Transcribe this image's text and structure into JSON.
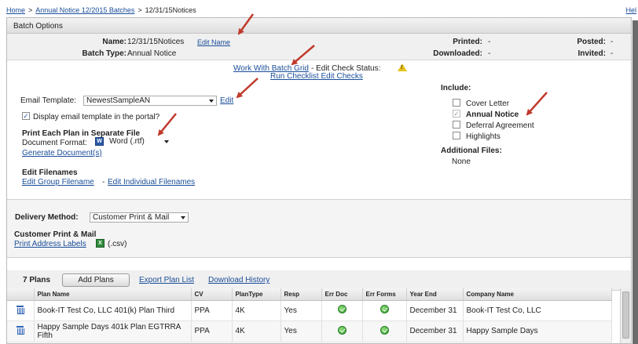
{
  "breadcrumb": {
    "home": "Home",
    "batches": "Annual Notice 12/2015 Batches",
    "current": "12/31/15Notices",
    "separator": ">",
    "help_fragment": "Hel"
  },
  "panel": {
    "title": "Batch Options"
  },
  "info": {
    "name_label": "Name:",
    "name_value": "12/31/15Notices",
    "edit_name": "Edit Name",
    "batch_type_label": "Batch Type:",
    "batch_type_value": "Annual Notice",
    "printed_label": "Printed:",
    "printed_value": "-",
    "downloaded_label": "Downloaded:",
    "downloaded_value": "-",
    "posted_label": "Posted:",
    "posted_value": "-",
    "invited_label": "Invited:",
    "invited_value": "-"
  },
  "main": {
    "work_with_batch_grid": "Work With Batch Grid",
    "edit_check_status": "- Edit Check Status:",
    "run_checklist": "Run Checklist Edit Checks",
    "email_template_label": "Email Template:",
    "email_template_value": "NewestSampleAN",
    "edit_template": "Edit",
    "display_template_label": "Display email template in the portal?",
    "display_template_checked": true,
    "print_each_plan": "Print Each Plan in Separate File",
    "document_format_label": "Document Format:",
    "document_format_value": "Word (.rtf)",
    "generate_documents": "Generate Document(s)",
    "edit_filenames": "Edit Filenames",
    "edit_group_filename": "Edit Group Filename",
    "filename_separator": "-",
    "edit_individual_filenames": "Edit Individual Filenames",
    "include_label": "Include:",
    "include_items": [
      {
        "label": "Cover Letter",
        "checked": false,
        "bold": false
      },
      {
        "label": "Annual Notice",
        "checked": true,
        "bold": true
      },
      {
        "label": "Deferral Agreement",
        "checked": false,
        "bold": false
      },
      {
        "label": "Highlights",
        "checked": false,
        "bold": false
      }
    ],
    "additional_files_label": "Additional Files:",
    "additional_files_value": "None"
  },
  "delivery": {
    "method_label": "Delivery Method:",
    "method_value": "Customer Print & Mail",
    "section_title": "Customer Print & Mail",
    "print_address_labels": "Print Address Labels",
    "csv_label": "(.csv)"
  },
  "plans": {
    "count_label": "7 Plans",
    "add_plans": "Add Plans",
    "export_plan_list": "Export Plan List",
    "download_history": "Download History",
    "columns": [
      "Plan Name",
      "CV",
      "PlanType",
      "Resp",
      "Err Doc",
      "Err Forms",
      "Year End",
      "Company Name"
    ],
    "rows": [
      {
        "plan_name": "Book-IT Test Co, LLC 401(k) Plan Third",
        "cv": "PPA",
        "plan_type": "4K",
        "resp": "Yes",
        "year_end": "December 31",
        "company": "Book-IT Test Co, LLC"
      },
      {
        "plan_name": "Happy Sample Days 401k Plan EGTRRA Fifth",
        "cv": "PPA",
        "plan_type": "4K",
        "resp": "Yes",
        "year_end": "December 31",
        "company": "Happy Sample Days"
      }
    ]
  },
  "colors": {
    "link": "#1a4d99",
    "annotation_arrow": "#c0392b",
    "ok": "#2f9a2a",
    "warning": "#e8c21a"
  }
}
